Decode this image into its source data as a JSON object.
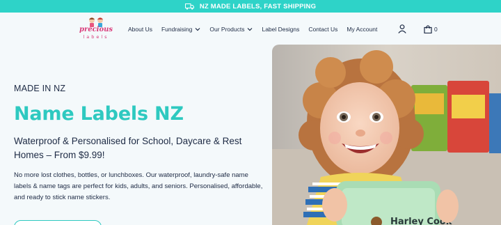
{
  "announcement": {
    "icon": "truck-icon",
    "text": "NZ MADE LABELS, FAST SHIPPING"
  },
  "logo": {
    "line1": "precious",
    "line2": "labels"
  },
  "nav": {
    "items": [
      {
        "label": "About Us",
        "dropdown": false
      },
      {
        "label": "Fundraising",
        "dropdown": true
      },
      {
        "label": "Our Products",
        "dropdown": true
      },
      {
        "label": "Label Designs",
        "dropdown": false
      },
      {
        "label": "Contact Us",
        "dropdown": false
      },
      {
        "label": "My Account",
        "dropdown": false
      }
    ],
    "cart_count": "0"
  },
  "hero": {
    "eyebrow": "MADE IN NZ",
    "title": "Name Labels NZ",
    "subtitle": "Waterproof & Personalised for School, Daycare & Rest Homes – From $9.99!",
    "body": "No more lost clothes, bottles, or lunchboxes. Our waterproof, laundry-safe name labels & name tags are perfect for kids, adults, and seniors. Personalised, affordable, and ready to stick name stickers.",
    "lunchbox_label": "Harley Cook"
  },
  "colors": {
    "accent": "#2ed3c8",
    "text": "#1d2a44",
    "brand": "#d93b7a"
  }
}
